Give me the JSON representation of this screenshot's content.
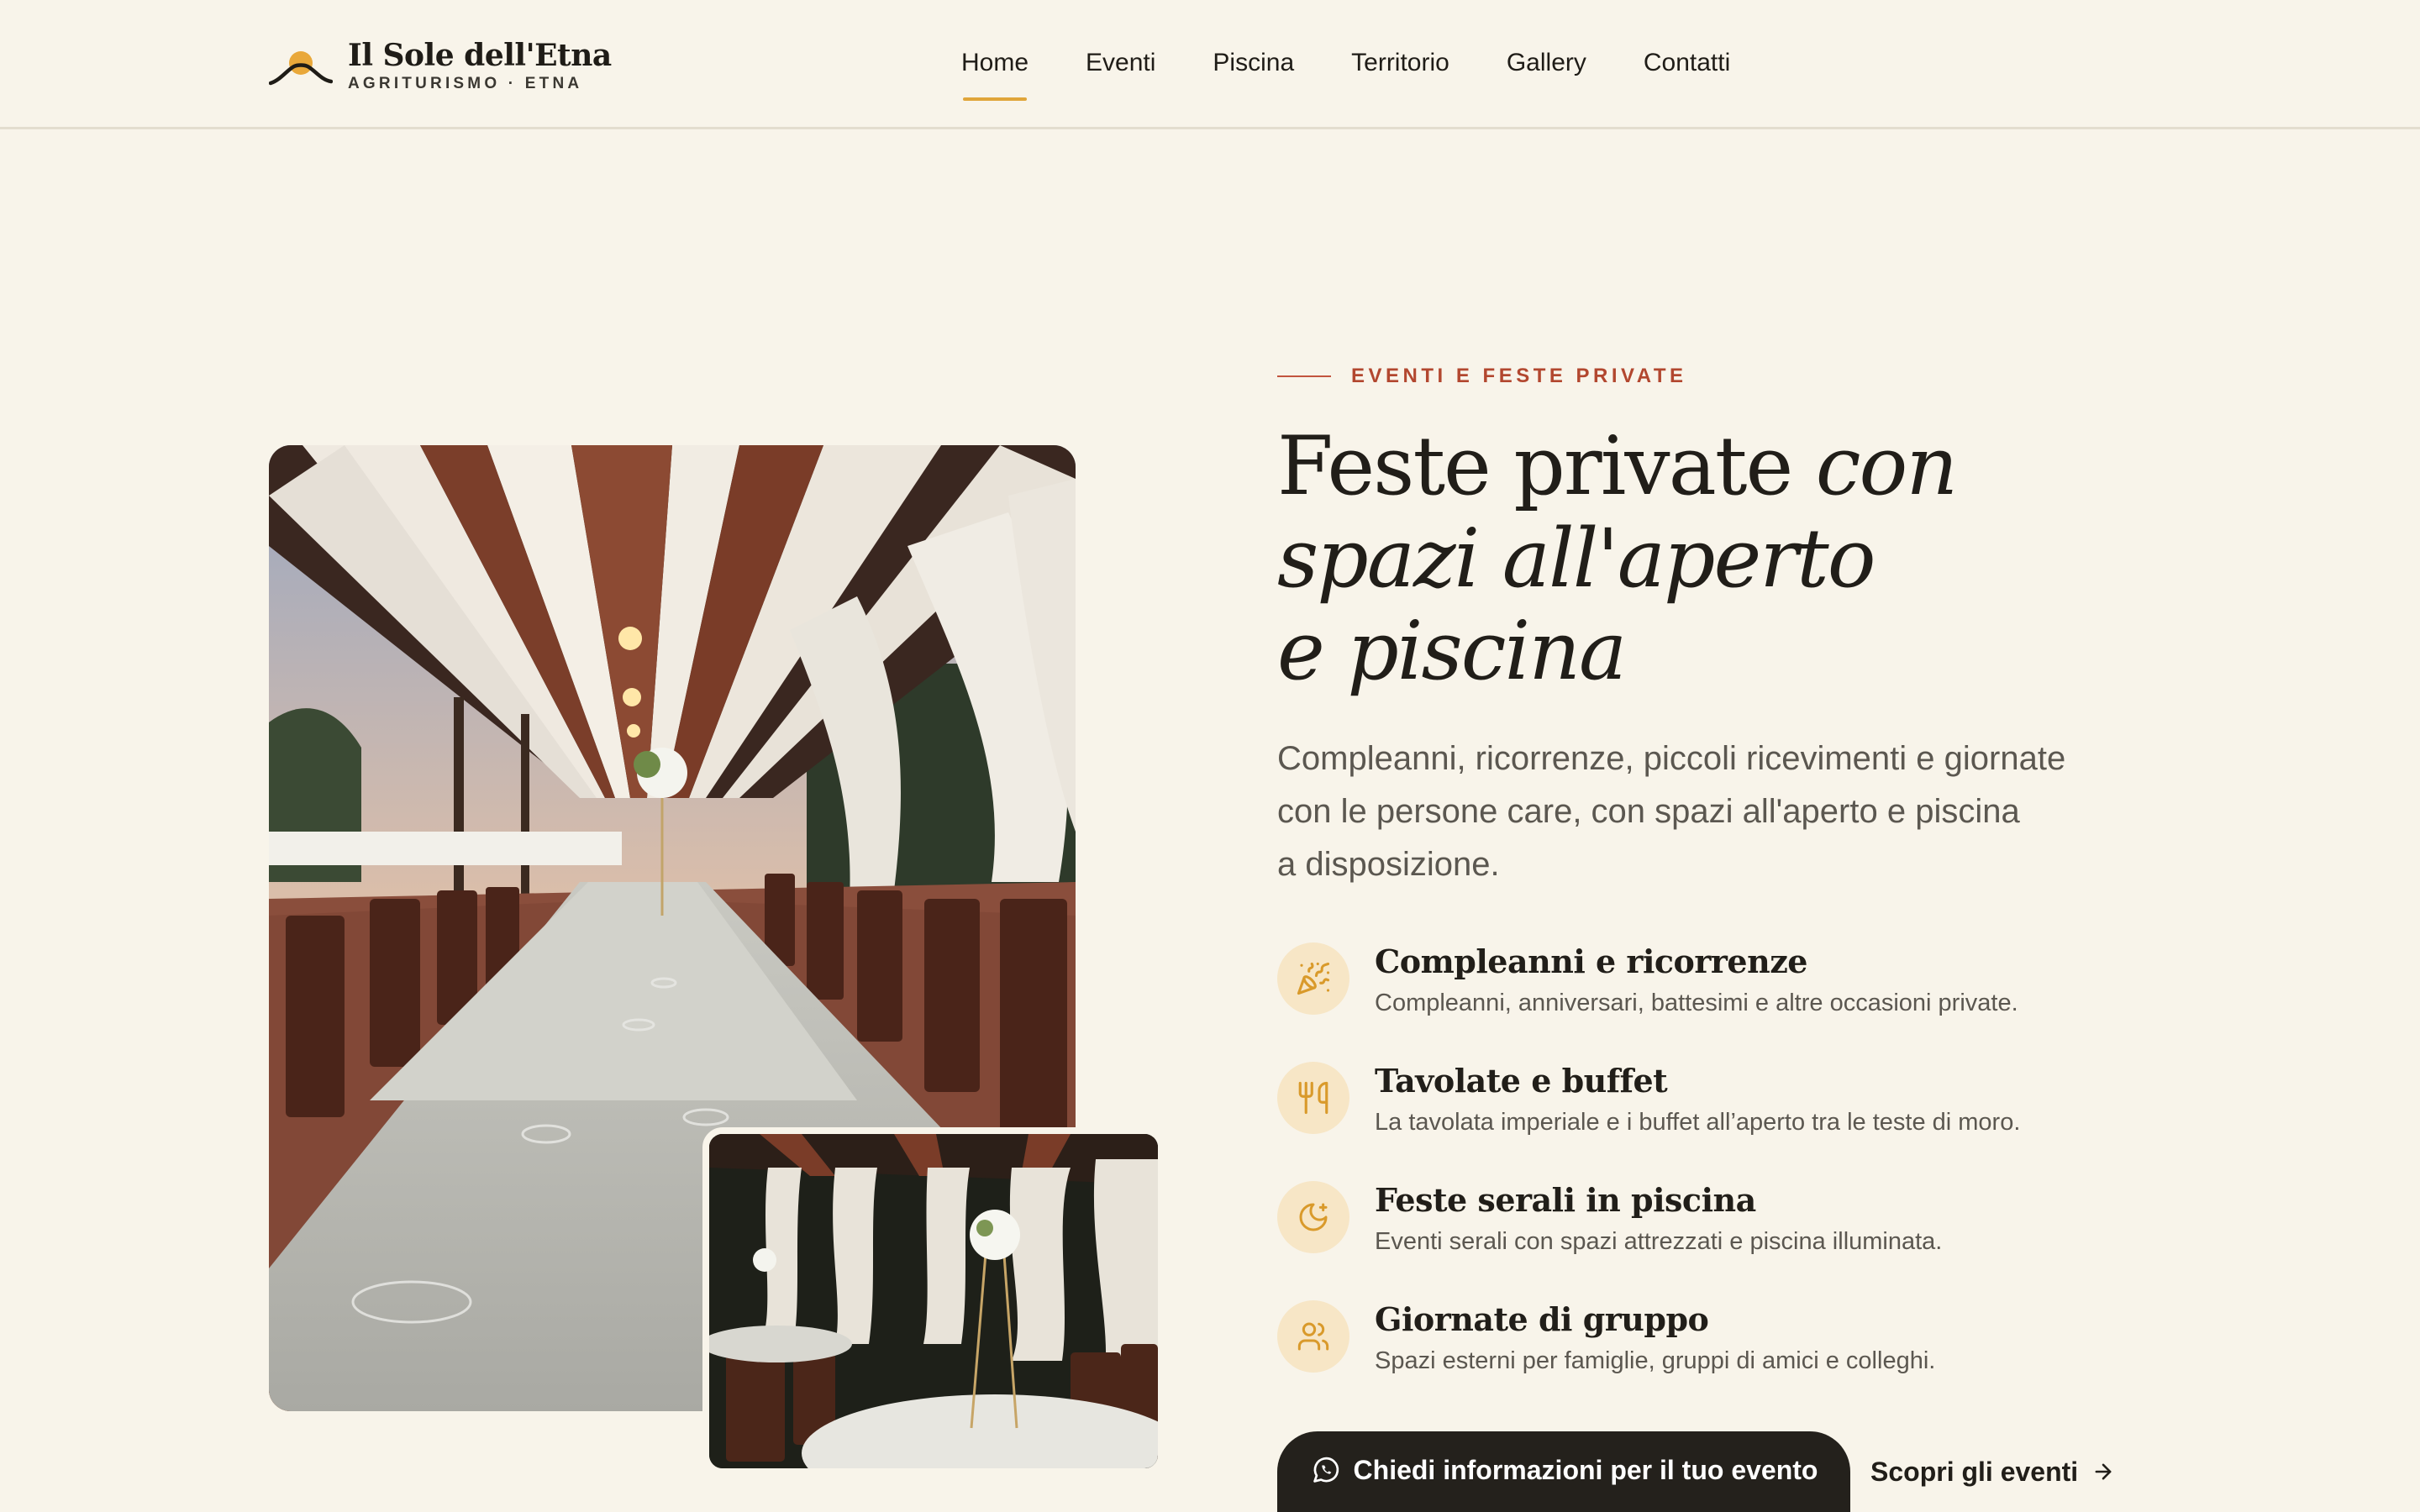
{
  "brand": {
    "name": "Il Sole dell'Etna",
    "tagline": "AGRITURISMO · ETNA"
  },
  "nav": [
    {
      "label": "Home",
      "active": true
    },
    {
      "label": "Eventi",
      "active": false
    },
    {
      "label": "Piscina",
      "active": false
    },
    {
      "label": "Territorio",
      "active": false
    },
    {
      "label": "Gallery",
      "active": false
    },
    {
      "label": "Contatti",
      "active": false
    }
  ],
  "hero": {
    "eyebrow": "EVENTI E FESTE PRIVATE",
    "headline_plain": "Feste private ",
    "headline_italic_1": "con",
    "headline_italic_2": "spazi all'aperto",
    "headline_italic_3": "e piscina",
    "lead_line1": "Compleanni, ricorrenze, piccoli ricevimenti e giornate",
    "lead_line2": "con le persone care, con spazi all'aperto e piscina",
    "lead_line3": "a disposizione."
  },
  "features": [
    {
      "icon": "party-popper-icon",
      "title": "Compleanni e ricorrenze",
      "desc": "Compleanni, anniversari, battesimi e altre occasioni private."
    },
    {
      "icon": "utensils-icon",
      "title": "Tavolate e buffet",
      "desc": "La tavolata imperiale e i buffet all’aperto tra le teste di moro."
    },
    {
      "icon": "moon-icon",
      "title": "Feste serali in piscina",
      "desc": "Eventi serali con spazi attrezzati e piscina illuminata."
    },
    {
      "icon": "users-icon",
      "title": "Giornate di gruppo",
      "desc": "Spazi esterni per famiglie, gruppi di amici e colleghi."
    }
  ],
  "actions": {
    "cta_label": "Chiedi informazioni per il tuo evento",
    "cta_icon": "whatsapp-icon",
    "more_label": "Scopri gli eventi",
    "more_icon": "arrow-right-icon"
  },
  "colors": {
    "background": "#f8f4ea",
    "accent": "#e0a53a",
    "eyebrow": "#b2472f",
    "icon_bg": "#f7e6c6",
    "button": "#24211c"
  }
}
